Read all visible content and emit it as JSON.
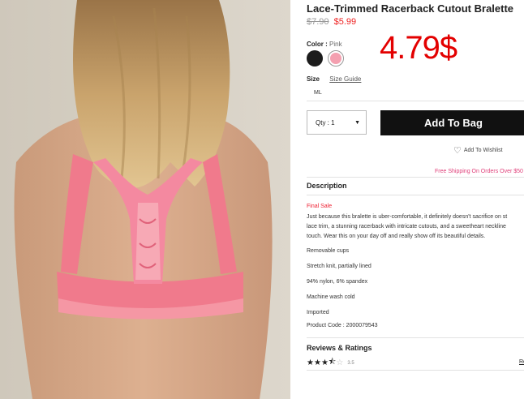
{
  "product": {
    "title": "Lace-Trimmed Racerback Cutout Bralette",
    "old_price": "$7.90",
    "new_price": "$5.99",
    "overlay_price": "4.79$",
    "image_alt": "pink-bralette-photo"
  },
  "color": {
    "label": "Color :",
    "value": "Pink",
    "swatches": [
      "#1c1c1c",
      "#f4a0b0"
    ]
  },
  "size": {
    "label": "Size",
    "guide_label": "Size Guide",
    "option": "ML"
  },
  "purchase": {
    "qty_label": "Qty : 1",
    "add_to_bag": "Add To Bag",
    "wishlist": "Add To Wishlist",
    "shipping_note": "Free Shipping On Orders Over $50"
  },
  "description": {
    "heading": "Description",
    "final_sale": "Final Sale",
    "lines": [
      "Just because this bralette is uber-comfortable, it definitely doesn't sacrifice on st",
      "lace trim, a stunning racerback with intricate cutouts, and a sweetheart neckline",
      "touch. Wear this on your day off and really show off its beautiful details."
    ],
    "features": [
      "Removable cups",
      "Stretch knit, partially lined",
      "94% nylon, 6% spandex",
      "Machine wash cold",
      "Imported"
    ],
    "product_code": "Product Code : 2000079543"
  },
  "reviews": {
    "heading": "Reviews & Ratings",
    "rating": "3.5",
    "stars_filled": 3.5,
    "stars_total": 5,
    "link": "Re"
  },
  "colors": {
    "accent_red": "#e30000",
    "button_black": "#111111",
    "shipping_pink": "#e0407a"
  }
}
